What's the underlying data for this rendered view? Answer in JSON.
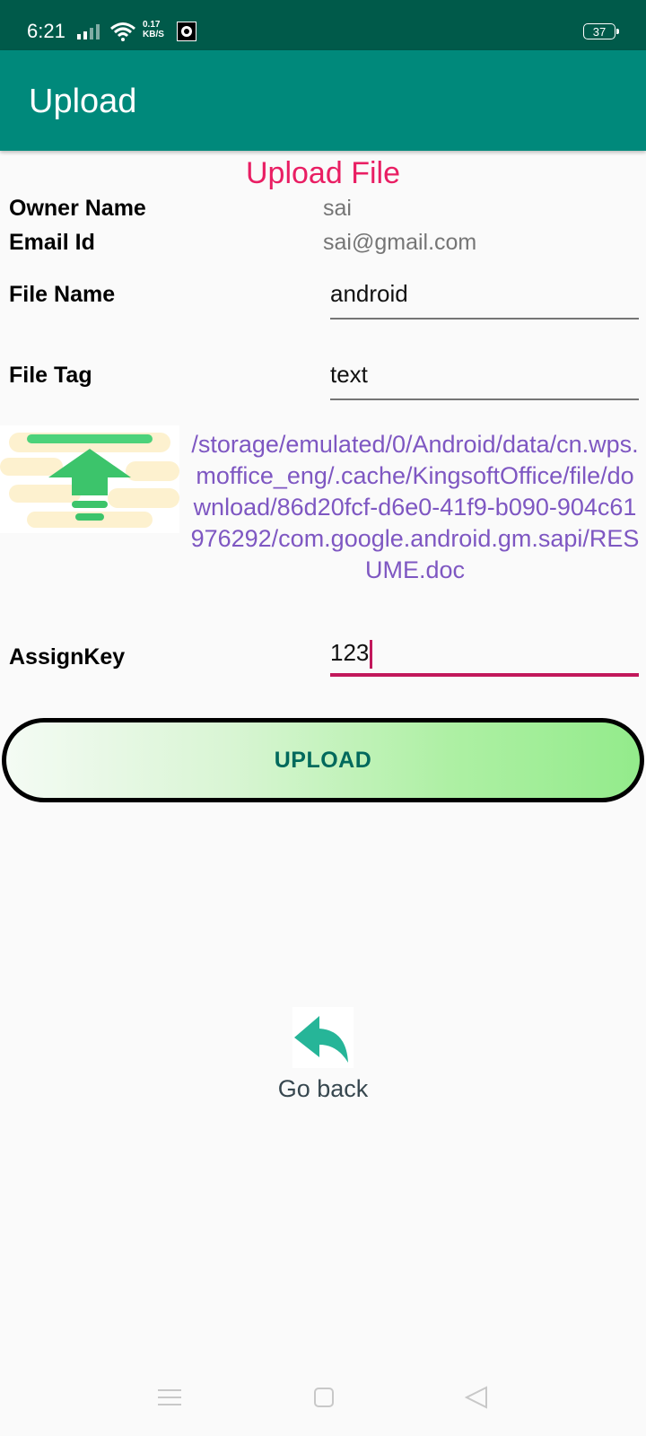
{
  "status_bar": {
    "time": "6:21",
    "network_speed_value": "0.17",
    "network_speed_unit": "KB/S",
    "battery": "37",
    "icons": [
      "signal-icon",
      "wifi-icon",
      "notification-app-icon",
      "battery-icon"
    ]
  },
  "app_bar": {
    "title": "Upload"
  },
  "page": {
    "heading": "Upload File",
    "owner_name_label": "Owner Name",
    "owner_name_value": "sai",
    "email_label": "Email Id",
    "email_value": "sai@gmail.com",
    "file_name_label": "File Name",
    "file_name_value": "android",
    "file_tag_label": "File Tag",
    "file_tag_value": "text",
    "file_path": "/storage/emulated/0/Android/data/cn.wps.moffice_eng/.cache/KingsoftOffice/file/download/86d20fcf-d6e0-41f9-b090-904c61976292/com.google.android.gm.sapi/RESUME.doc",
    "assign_key_label": "AssignKey",
    "assign_key_value": "123",
    "upload_button": "UPLOAD",
    "go_back": "Go back"
  },
  "colors": {
    "status_bar": "#005a4a",
    "app_bar": "#00897b",
    "heading": "#e91e63",
    "file_path": "#7e57c2",
    "active_underline": "#c2185b",
    "upload_text": "#00695c",
    "back_icon": "#26b598"
  },
  "nav_bar": {
    "icons": [
      "menu-icon",
      "home-icon",
      "back-triangle-icon"
    ]
  }
}
